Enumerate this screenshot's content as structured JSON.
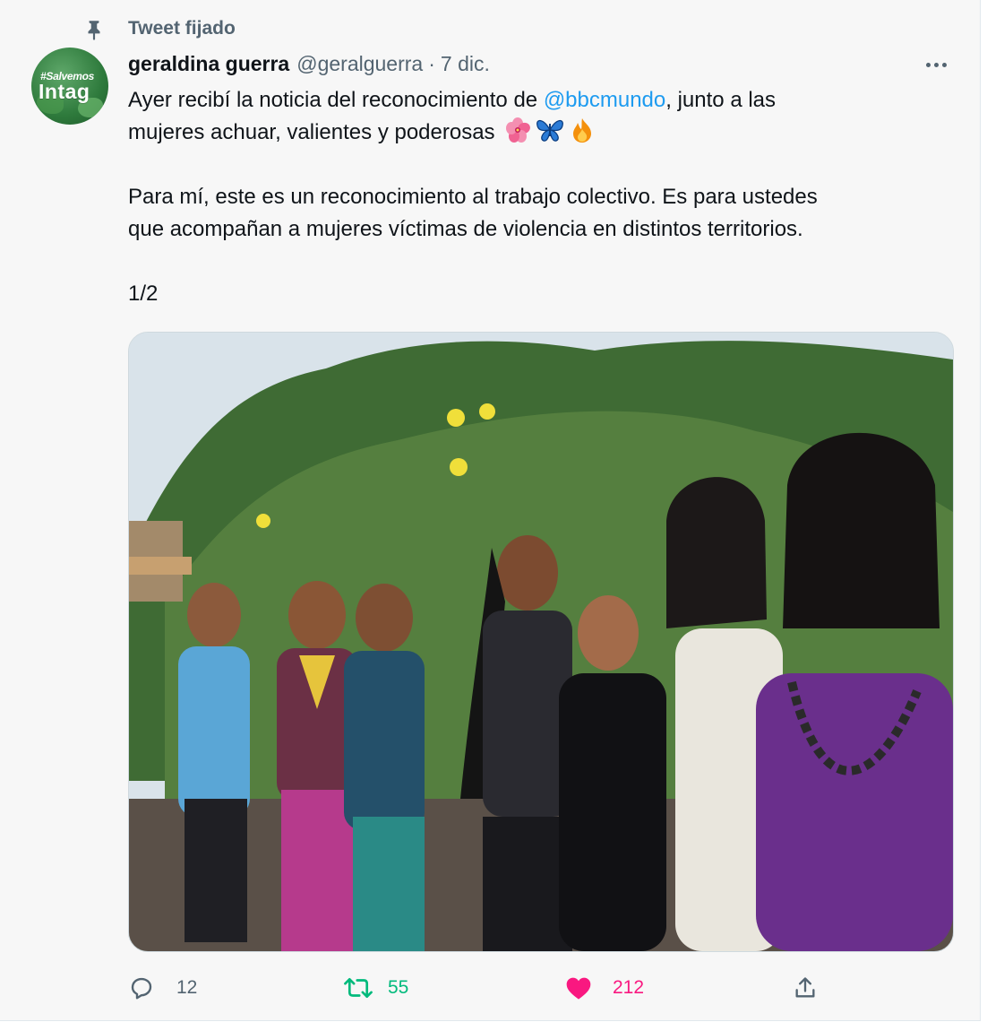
{
  "pinned": {
    "label": "Tweet fijado"
  },
  "author": {
    "display_name": "geraldina guerra",
    "handle": "@geralguerra",
    "separator": "·",
    "date": "7 dic.",
    "avatar_text_top": "#Salvemos",
    "avatar_text_main": "Intag"
  },
  "tweet": {
    "line1_before": "Ayer recibí la noticia del reconocimiento de ",
    "mention": "@bbcmundo",
    "line1_after": ", junto a las",
    "line2": "mujeres achuar, valientes y poderosas",
    "emojis": [
      "hibiscus-icon",
      "butterfly-icon",
      "fire-icon"
    ],
    "paragraph2_line1": "Para mí, este es un reconocimiento al trabajo colectivo. Es para ustedes",
    "paragraph2_line2": "que acompañan a mujeres víctimas de violencia en distintos territorios.",
    "paragraph3": "1/2"
  },
  "actions": {
    "replies": "12",
    "retweets": "55",
    "likes": "212"
  },
  "colors": {
    "mention": "#1d9bf0",
    "retweet": "#00ba7c",
    "like": "#f91880",
    "muted": "#536471"
  }
}
